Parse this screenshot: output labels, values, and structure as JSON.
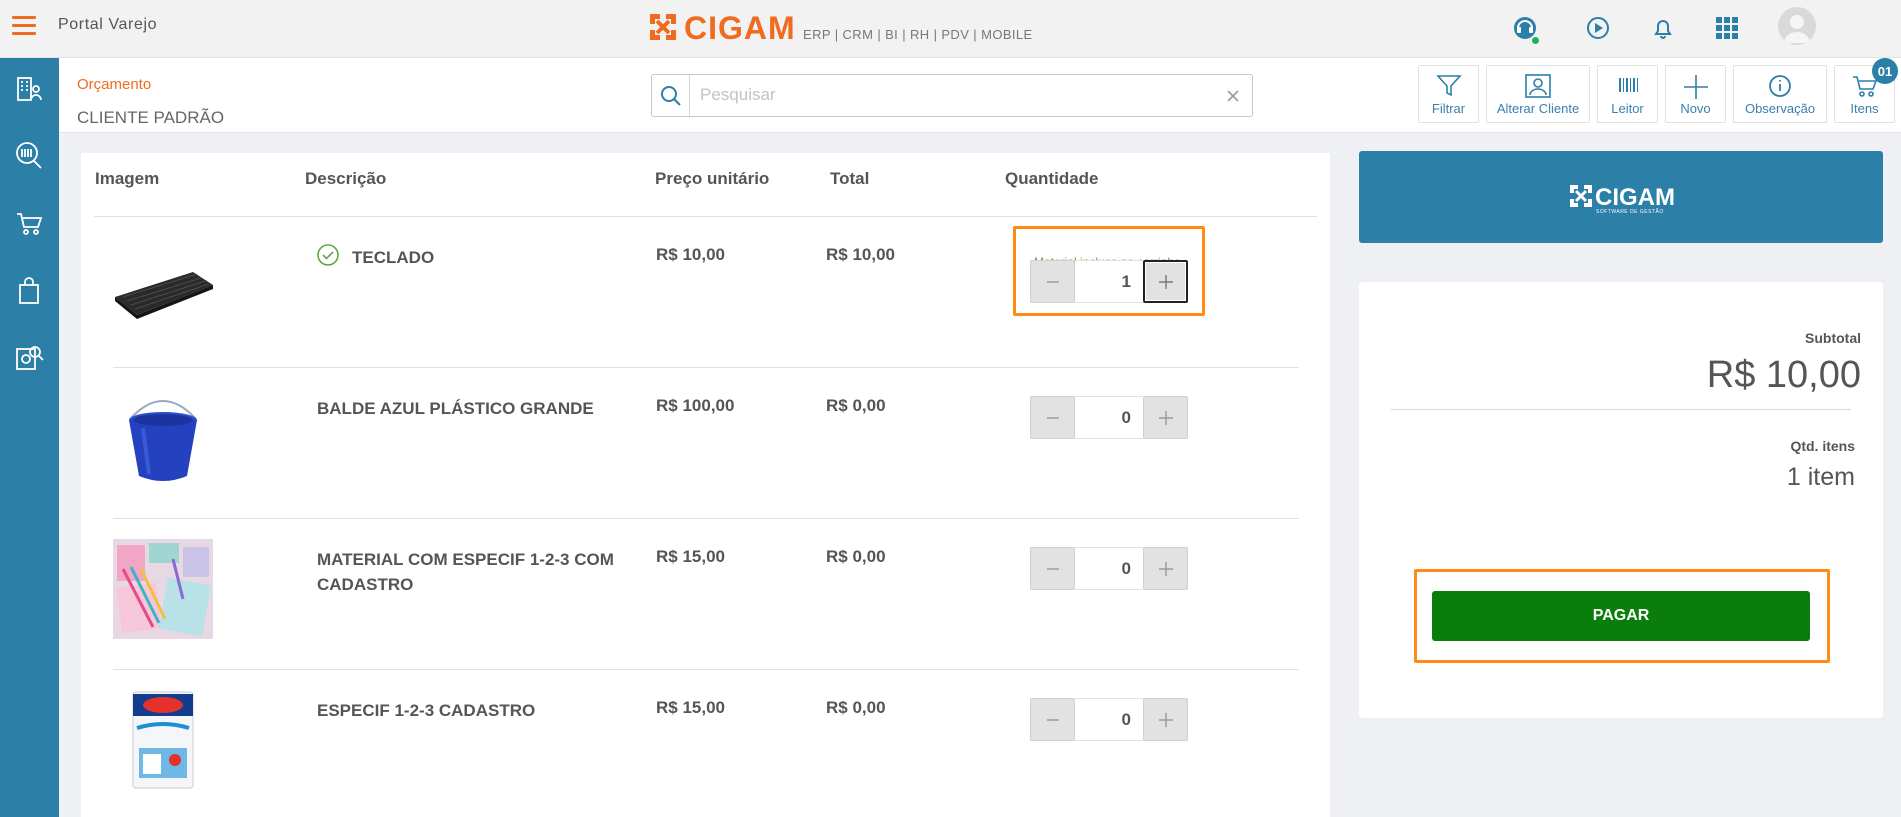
{
  "topbar": {
    "portal_title": "Portal Varejo",
    "brand_name": "CIGAM",
    "brand_tagline": "ERP | CRM | BI | RH | PDV | MOBILE",
    "icons": [
      "support-icon",
      "play-icon",
      "bell-icon",
      "apps-grid-icon",
      "avatar"
    ]
  },
  "sidebar": {
    "items": [
      "building-user-icon",
      "barcode-search-icon",
      "cart-icon",
      "shopping-bag-icon",
      "report-search-icon"
    ]
  },
  "header": {
    "doc_type": "Orçamento",
    "client": "CLIENTE PADRÃO",
    "search_placeholder": "Pesquisar",
    "search_value": ""
  },
  "toolbar": [
    {
      "label": "Filtrar",
      "icon": "filter-icon"
    },
    {
      "label": "Alterar Cliente",
      "icon": "change-client-icon"
    },
    {
      "label": "Leitor",
      "icon": "barcode-icon"
    },
    {
      "label": "Novo",
      "icon": "plus-icon"
    },
    {
      "label": "Observação",
      "icon": "info-icon"
    },
    {
      "label": "Itens",
      "icon": "cart-icon",
      "badge": "01"
    }
  ],
  "table": {
    "columns": [
      "Imagem",
      "Descrição",
      "Preço unitário",
      "Total",
      "Quantidade"
    ],
    "rows": [
      {
        "description": "TECLADO",
        "price": "R$ 10,00",
        "total": "R$ 10,00",
        "quantity": "1",
        "in_cart": true,
        "note": "Material incluso no carrinho",
        "image": "keyboard"
      },
      {
        "description": "BALDE AZUL PLÁSTICO GRANDE",
        "price": "R$ 100,00",
        "total": "R$ 0,00",
        "quantity": "0",
        "in_cart": false,
        "image": "blue-bucket"
      },
      {
        "description": "MATERIAL COM ESPECIF 1-2-3 COM CADASTRO",
        "price": "R$ 15,00",
        "total": "R$ 0,00",
        "quantity": "0",
        "in_cart": false,
        "image": "stationery"
      },
      {
        "description": "ESPECIF 1-2-3 CADASTRO",
        "price": "R$ 15,00",
        "total": "R$ 0,00",
        "quantity": "0",
        "in_cart": false,
        "image": "paint-can"
      }
    ]
  },
  "summary": {
    "brand": "CIGAM",
    "brand_sub": "SOFTWARE DE GESTÃO",
    "subtotal_label": "Subtotal",
    "subtotal_value": "R$ 10,00",
    "items_label": "Qtd. itens",
    "items_value": "1 item",
    "pay_label": "PAGAR"
  },
  "colors": {
    "accent_orange": "#ef6b1f",
    "sidebar_blue": "#2c7fa6",
    "pay_green": "#0a7d0a",
    "highlight": "#ff8a17",
    "success_green": "#64a541"
  }
}
